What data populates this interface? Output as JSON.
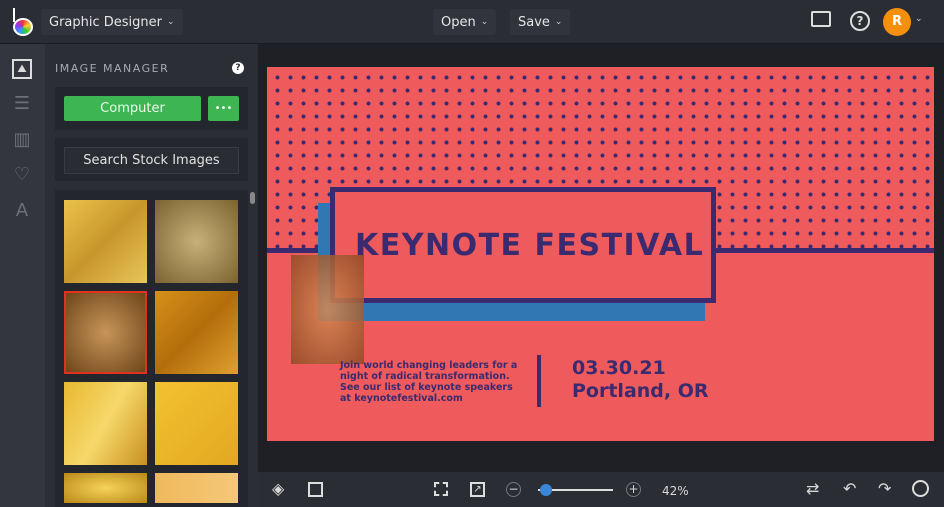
{
  "topbar": {
    "app_mode": "Graphic Designer",
    "open_label": "Open",
    "save_label": "Save",
    "avatar_initial": "R"
  },
  "panel": {
    "title": "IMAGE MANAGER",
    "computer_label": "Computer",
    "more_label": "•••",
    "search_stock_label": "Search Stock Images"
  },
  "poster": {
    "title": "KEYNOTE FESTIVAL",
    "body_lines": [
      "Join world changing leaders for a",
      "night of radical transformation.",
      "See our list of keynote speakers",
      "at keynotefestival.com"
    ],
    "date": "03.30.21",
    "location": "Portland, OR"
  },
  "bottombar": {
    "zoom_value": "42%",
    "zoom_fraction": 0.05
  },
  "colors": {
    "accent_green": "#3cb552",
    "poster_coral": "#ef5b5c",
    "poster_navy": "#3b2a6f",
    "poster_blue": "#2f78b3",
    "avatar": "#f5900f",
    "slider": "#3a87d8"
  }
}
